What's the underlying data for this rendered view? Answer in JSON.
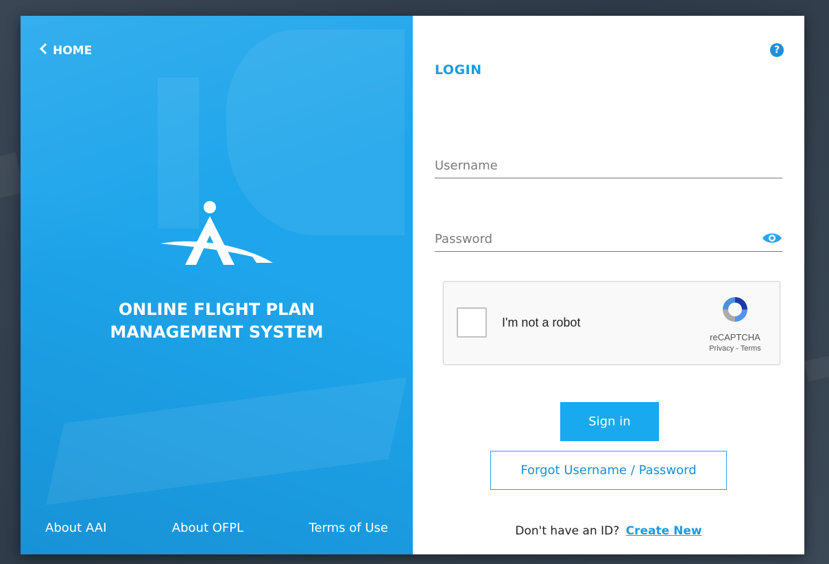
{
  "left_panel": {
    "home_label": "HOME",
    "title_line1": "ONLINE FLIGHT PLAN",
    "title_line2": "MANAGEMENT SYSTEM",
    "footer_links": [
      "About AAI",
      "About OFPL",
      "Terms of Use"
    ],
    "background_color": "#1ea5eb"
  },
  "login": {
    "title": "LOGIN",
    "help_symbol": "?",
    "username_placeholder": "Username",
    "password_placeholder": "Password",
    "captcha": {
      "label": "I'm not a robot",
      "brand": "reCAPTCHA",
      "privacy_terms": "Privacy - Terms"
    },
    "sign_in_label": "Sign in",
    "forgot_label": "Forgot Username / Password",
    "no_id_text": "Don't have an ID?",
    "create_new_label": "Create New",
    "accent_color": "#19a9ee"
  },
  "icons": {
    "back": "chevron-left-icon",
    "help": "question-circle-icon",
    "eye": "eye-icon",
    "logo": "aai-logo-icon",
    "captcha": "recaptcha-icon"
  }
}
